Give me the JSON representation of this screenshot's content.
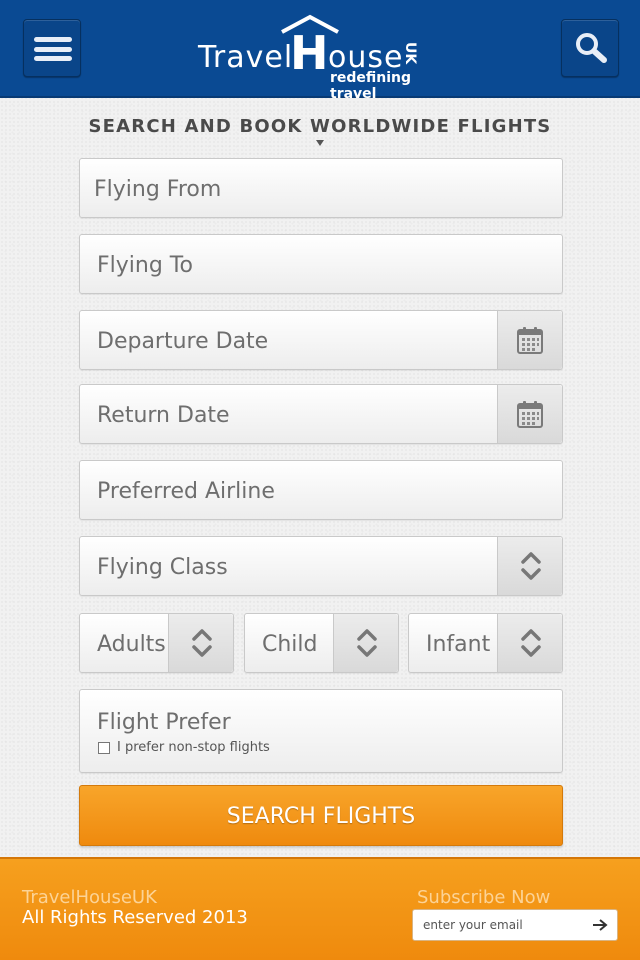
{
  "header": {
    "logo_travel": "Travel",
    "logo_h": "H",
    "logo_ouse": "ouse",
    "logo_uk": "UK",
    "logo_tagline": "redefining travel",
    "menu_icon": "hamburger-menu-icon",
    "search_icon": "magnifier-icon"
  },
  "page_title": "SEARCH AND BOOK WORLDWIDE FLIGHTS",
  "form": {
    "flying_from": "Flying From",
    "flying_to": "Flying To",
    "departure_date": "Departure Date",
    "return_date": "Return Date",
    "preferred_airline": "Preferred Airline",
    "flying_class": "Flying Class",
    "adults": "Adults",
    "child": "Child",
    "infant": "Infant",
    "flight_prefer": "Flight Prefer",
    "non_stop_label": "I prefer non-stop flights",
    "submit_label": "SEARCH FLIGHTS"
  },
  "footer": {
    "brand": "TravelHouseUK",
    "rights": "All Rights Reserved 2013",
    "subscribe_label": "Subscribe Now",
    "email_placeholder": "enter your email"
  },
  "colors": {
    "header_blue": "#0a4a93",
    "accent_orange": "#f39a1a"
  }
}
